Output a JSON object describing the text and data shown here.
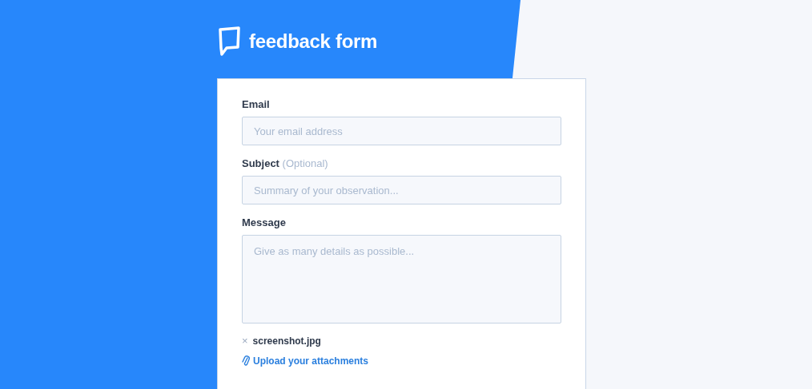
{
  "header": {
    "title": "feedback form"
  },
  "fields": [
    {
      "kind": "input",
      "label": "Email",
      "placeholder": "Your email address"
    },
    {
      "kind": "input",
      "label": "Subject",
      "note": "(Optional)",
      "placeholder": "Summary of your observation..."
    },
    {
      "kind": "textarea",
      "label": "Message",
      "placeholder": "Give as many details as possible..."
    }
  ],
  "attachments": [
    {
      "remove": "×",
      "name": "screenshot.jpg"
    }
  ],
  "upload_link": "Upload your attachments"
}
